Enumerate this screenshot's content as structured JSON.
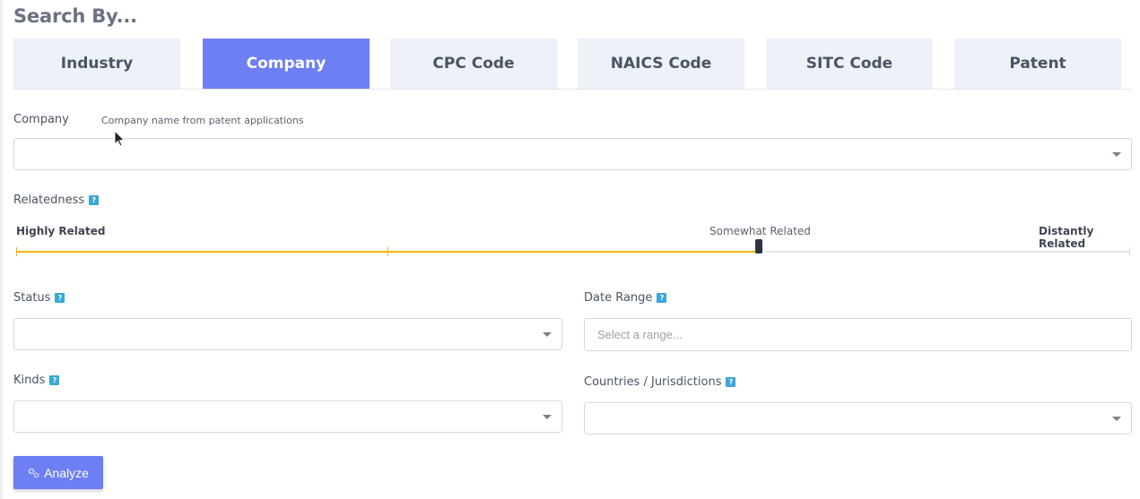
{
  "heading": "Search By...",
  "tabs": [
    {
      "label": "Industry",
      "active": false
    },
    {
      "label": "Company",
      "active": true
    },
    {
      "label": "CPC Code",
      "active": false
    },
    {
      "label": "NAICS Code",
      "active": false
    },
    {
      "label": "SITC Code",
      "active": false
    },
    {
      "label": "Patent",
      "active": false
    }
  ],
  "company": {
    "label": "Company",
    "hint": "Company name from patent applications",
    "value": ""
  },
  "relatedness": {
    "label": "Relatedness",
    "help": "?",
    "min_label": "Highly Related",
    "mid_label": "Somewhat Related",
    "max_label": "Distantly Related",
    "value_fraction": 0.667
  },
  "status": {
    "label": "Status",
    "help": "?",
    "value": ""
  },
  "date_range": {
    "label": "Date Range",
    "help": "?",
    "placeholder": "Select a range..."
  },
  "kinds": {
    "label": "Kinds",
    "help": "?",
    "value": ""
  },
  "countries": {
    "label": "Countries / Jurisdictions",
    "help": "?",
    "value": ""
  },
  "analyze_button": {
    "label": "Analyze",
    "icon": "cogs-icon"
  },
  "colors": {
    "accent": "#6e7ff3",
    "slider_fill": "#f2b705",
    "help_badge": "#3aa7d9"
  }
}
